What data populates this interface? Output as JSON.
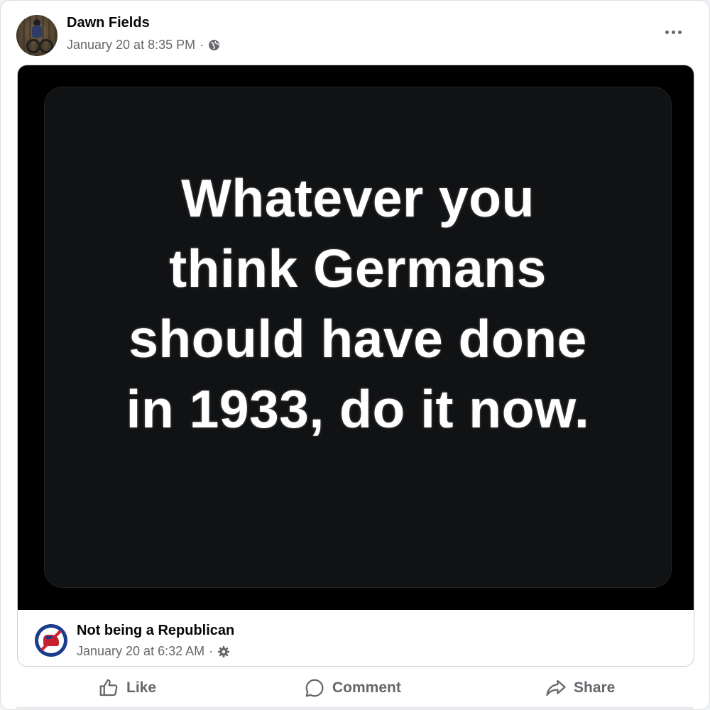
{
  "post": {
    "author": "Dawn Fields",
    "timestamp": "January 20 at 8:35 PM",
    "separator": "·",
    "privacy_icon": "globe-icon"
  },
  "shared": {
    "quote_lines": [
      "Whatever you",
      "think Germans",
      "should have done",
      "in 1933, do it now."
    ],
    "page_name": "Not being a Republican",
    "page_timestamp": "January 20 at 6:32 AM",
    "separator": "·",
    "privacy_icon": "gear-icon"
  },
  "actions": {
    "like_label": "Like",
    "comment_label": "Comment",
    "share_label": "Share"
  },
  "colors": {
    "secondary_text": "#65676b",
    "primary_text": "#050505",
    "image_background": "#000000"
  }
}
